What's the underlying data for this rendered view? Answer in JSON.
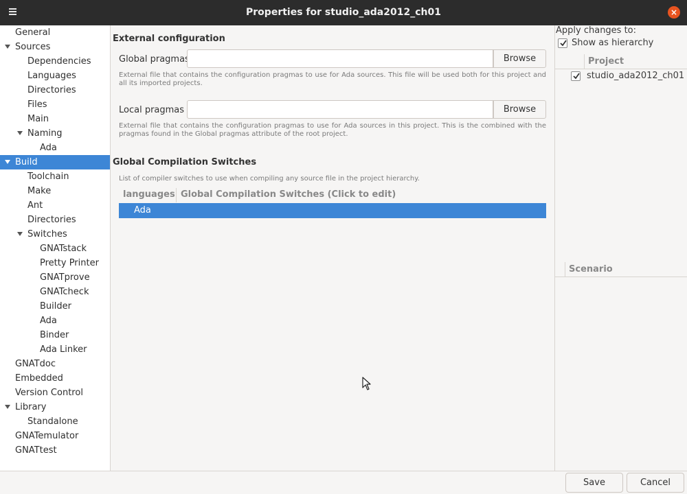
{
  "window": {
    "title": "Properties for studio_ada2012_ch01"
  },
  "tree": [
    {
      "label": "General",
      "level": 0,
      "expandable": false,
      "selected": false
    },
    {
      "label": "Sources",
      "level": 0,
      "expandable": true,
      "selected": false
    },
    {
      "label": "Dependencies",
      "level": 1,
      "expandable": false,
      "selected": false
    },
    {
      "label": "Languages",
      "level": 1,
      "expandable": false,
      "selected": false
    },
    {
      "label": "Directories",
      "level": 1,
      "expandable": false,
      "selected": false
    },
    {
      "label": "Files",
      "level": 1,
      "expandable": false,
      "selected": false
    },
    {
      "label": "Main",
      "level": 1,
      "expandable": false,
      "selected": false
    },
    {
      "label": "Naming",
      "level": 1,
      "expandable": true,
      "selected": false
    },
    {
      "label": "Ada",
      "level": 2,
      "expandable": false,
      "selected": false
    },
    {
      "label": "Build",
      "level": 0,
      "expandable": true,
      "selected": true
    },
    {
      "label": "Toolchain",
      "level": 1,
      "expandable": false,
      "selected": false
    },
    {
      "label": "Make",
      "level": 1,
      "expandable": false,
      "selected": false
    },
    {
      "label": "Ant",
      "level": 1,
      "expandable": false,
      "selected": false
    },
    {
      "label": "Directories",
      "level": 1,
      "expandable": false,
      "selected": false
    },
    {
      "label": "Switches",
      "level": 1,
      "expandable": true,
      "selected": false
    },
    {
      "label": "GNATstack",
      "level": 2,
      "expandable": false,
      "selected": false
    },
    {
      "label": "Pretty Printer",
      "level": 2,
      "expandable": false,
      "selected": false
    },
    {
      "label": "GNATprove",
      "level": 2,
      "expandable": false,
      "selected": false
    },
    {
      "label": "GNATcheck",
      "level": 2,
      "expandable": false,
      "selected": false
    },
    {
      "label": "Builder",
      "level": 2,
      "expandable": false,
      "selected": false
    },
    {
      "label": "Ada",
      "level": 2,
      "expandable": false,
      "selected": false
    },
    {
      "label": "Binder",
      "level": 2,
      "expandable": false,
      "selected": false
    },
    {
      "label": "Ada Linker",
      "level": 2,
      "expandable": false,
      "selected": false
    },
    {
      "label": "GNATdoc",
      "level": 0,
      "expandable": false,
      "selected": false
    },
    {
      "label": "Embedded",
      "level": 0,
      "expandable": false,
      "selected": false
    },
    {
      "label": "Version Control",
      "level": 0,
      "expandable": false,
      "selected": false
    },
    {
      "label": "Library",
      "level": 0,
      "expandable": true,
      "selected": false
    },
    {
      "label": "Standalone",
      "level": 1,
      "expandable": false,
      "selected": false
    },
    {
      "label": "GNATemulator",
      "level": 0,
      "expandable": false,
      "selected": false
    },
    {
      "label": "GNATtest",
      "level": 0,
      "expandable": false,
      "selected": false
    }
  ],
  "main": {
    "external_heading": "External configuration",
    "global_pragmas": {
      "label": "Global pragmas",
      "value": "",
      "browse": "Browse",
      "description": "External file that contains the configuration pragmas to use for Ada sources. This file will be used both for this project and all its imported projects."
    },
    "local_pragmas": {
      "label": "Local pragmas",
      "value": "",
      "browse": "Browse",
      "description": "External file that contains the configuration pragmas to use for Ada sources in this project. This is the combined with the pragmas found in the Global pragmas attribute of the root project."
    },
    "switches_heading": "Global Compilation Switches",
    "switches_description": "List of compiler switches to use when compiling any source file in the project hierarchy.",
    "switches_columns": [
      "languages",
      "Global Compilation Switches (Click to edit)"
    ],
    "switches_rows": [
      {
        "language": "Ada",
        "switches": ""
      }
    ]
  },
  "right": {
    "apply_label": "Apply changes to:",
    "show_hierarchy_label": "Show as hierarchy",
    "show_hierarchy_checked": true,
    "project_column": "Project",
    "projects": [
      {
        "name": "studio_ada2012_ch01",
        "checked": true
      }
    ],
    "scenario_column": "Scenario"
  },
  "buttons": {
    "save": "Save",
    "cancel": "Cancel"
  },
  "colors": {
    "selection": "#3d86d6",
    "titlebar": "#2c2c2c",
    "close": "#e95420"
  }
}
